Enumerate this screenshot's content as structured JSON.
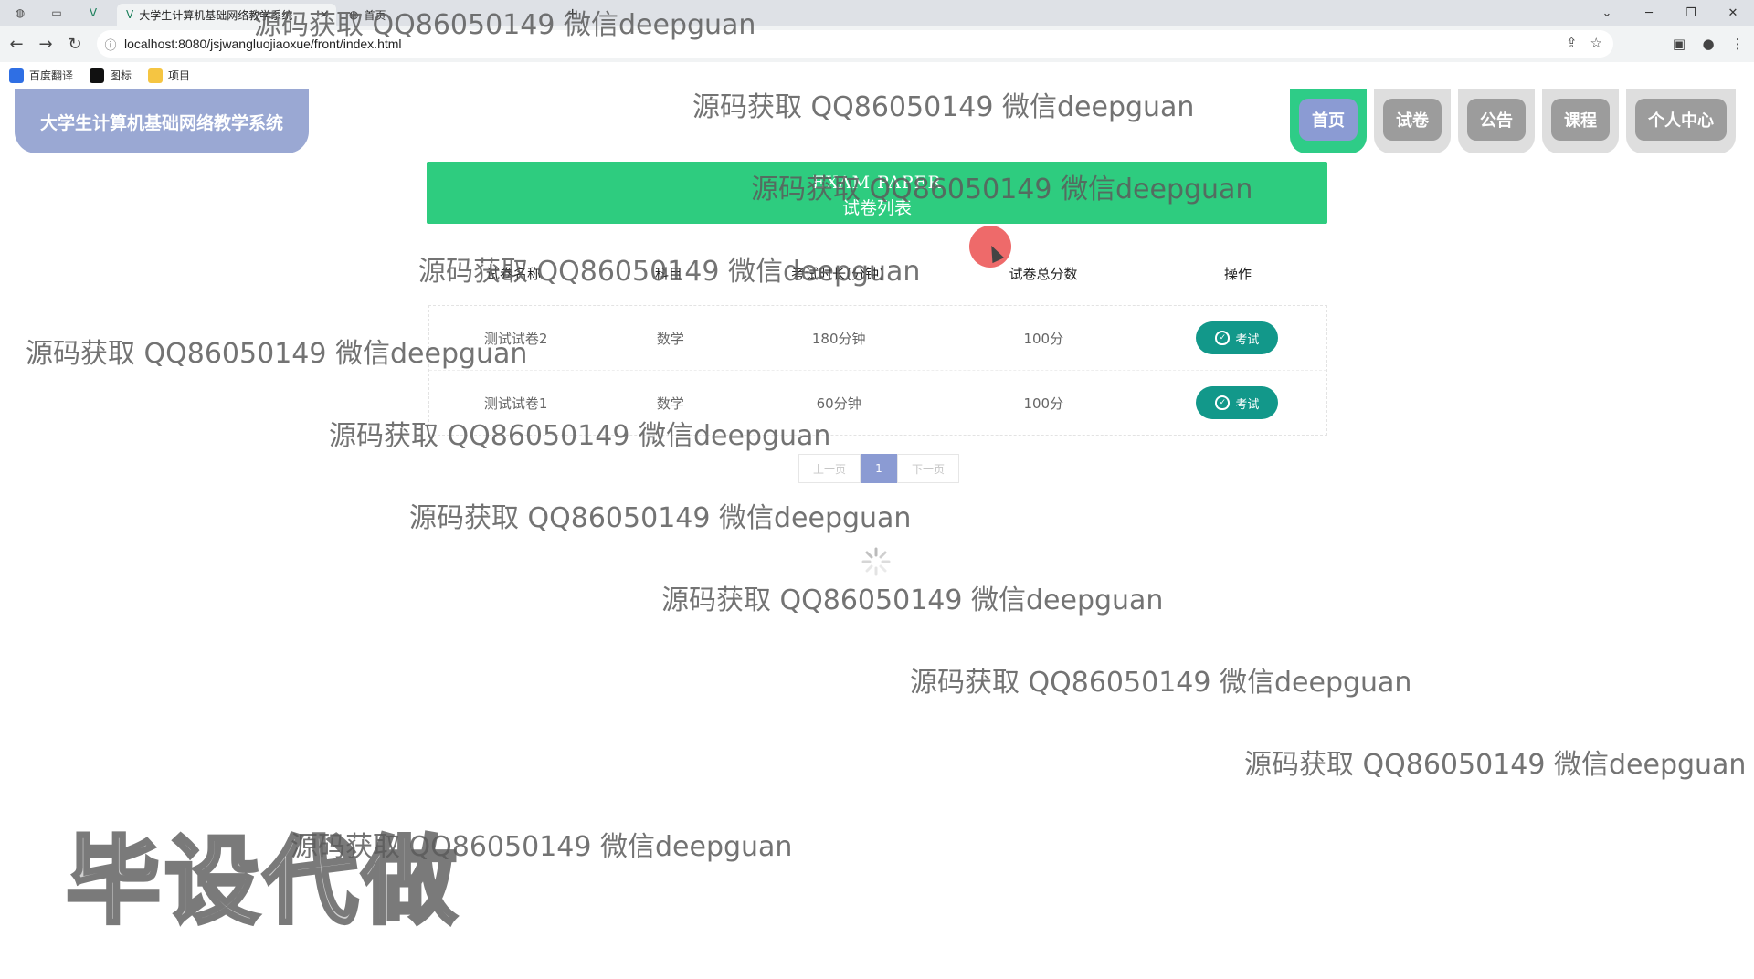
{
  "browser": {
    "tab_title": "大学生计算机基础网络教学系统",
    "tab2_title": "首页",
    "url": "localhost:8080/jsjwangluojiaoxue/front/index.html",
    "bookmarks": [
      {
        "label": "百度翻译",
        "icon": "translate-icon",
        "color": "#2f6fe4"
      },
      {
        "label": "图标",
        "icon": "image-icon",
        "color": "#111111"
      },
      {
        "label": "项目",
        "icon": "folder-icon",
        "color": "#f5c542"
      }
    ]
  },
  "site": {
    "title": "大学生计算机基础网络教学系统",
    "nav": [
      {
        "label": "首页",
        "active": true
      },
      {
        "label": "试卷",
        "active": false
      },
      {
        "label": "公告",
        "active": false
      },
      {
        "label": "课程",
        "active": false
      },
      {
        "label": "个人中心",
        "active": false
      }
    ]
  },
  "banner": {
    "en": "EXAM PAPER",
    "zh": "试卷列表"
  },
  "table": {
    "headers": [
      "试卷名称",
      "科目",
      "考试时长(分钟)",
      "试卷总分数",
      "操作"
    ],
    "rows": [
      {
        "name": "测试试卷2",
        "subject": "数学",
        "duration": "180分钟",
        "score": "100分",
        "action": "考试"
      },
      {
        "name": "测试试卷1",
        "subject": "数学",
        "duration": "60分钟",
        "score": "100分",
        "action": "考试"
      }
    ]
  },
  "pager": {
    "prev": "上一页",
    "current": "1",
    "next": "下一页"
  },
  "watermark": {
    "text": "源码获取 QQ86050149 微信deepguan",
    "big": "毕设代做"
  },
  "colors": {
    "banner": "#2ecc7f",
    "nav_active_outer": "#2ecc87",
    "nav_active_inner": "#8b9bd3",
    "logo_bg": "#9aa8d3",
    "exam_button": "#12988a"
  }
}
